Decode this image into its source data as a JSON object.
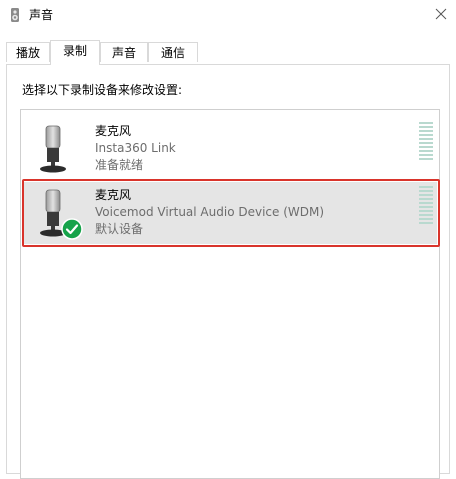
{
  "window": {
    "title": "声音",
    "close_symbol": "✕"
  },
  "tabs": [
    {
      "label": "播放",
      "active": false
    },
    {
      "label": "录制",
      "active": true
    },
    {
      "label": "声音",
      "active": false
    },
    {
      "label": "通信",
      "active": false
    }
  ],
  "recording": {
    "instruction": "选择以下录制设备来修改设置:",
    "devices": [
      {
        "name": "麦克风",
        "description": "Insta360 Link",
        "status": "准备就绪",
        "icon": "microphone-icon",
        "is_default": false,
        "selected": false
      },
      {
        "name": "麦克风",
        "description": "Voicemod Virtual Audio Device (WDM)",
        "status": "默认设备",
        "icon": "microphone-icon",
        "badge_icon": "default-check-icon",
        "is_default": true,
        "selected": true
      }
    ]
  },
  "colors": {
    "selection_bg": "#e5e5e5",
    "highlight_border": "#d9342b",
    "check_green": "#16a34a",
    "meter_bar": "#b9d9cf",
    "secondary_text": "#6d6d6d",
    "border": "#d9d9d9"
  }
}
